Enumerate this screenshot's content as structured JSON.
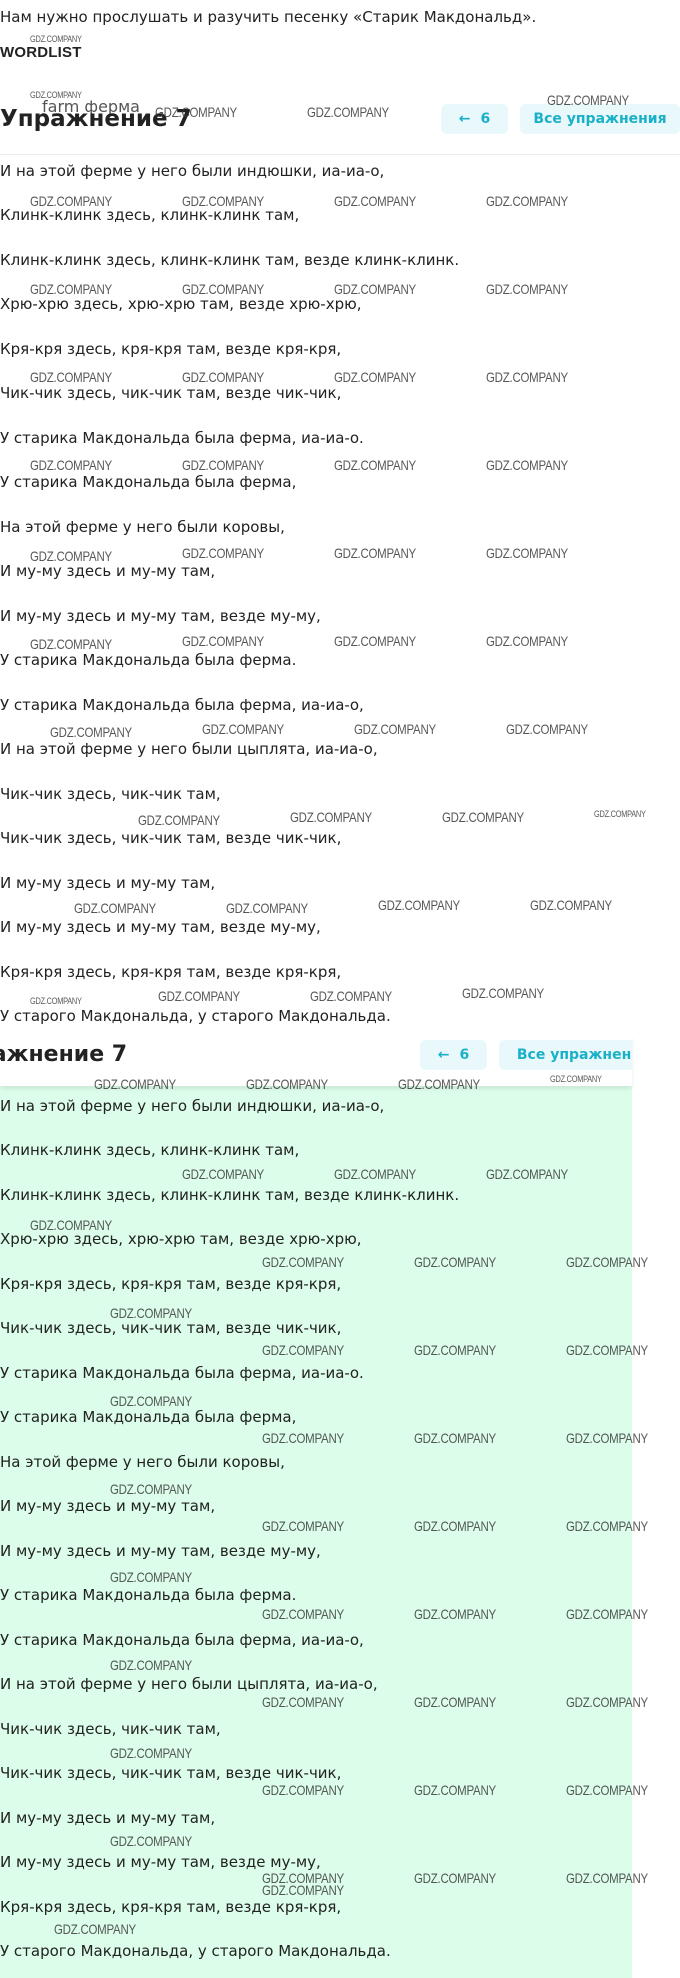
{
  "intro_text": "Нам нужно прослушать и разучить песенку «Старик Макдональд».",
  "wordlist_label": "WORDLIST",
  "farm_ghost": "farm  ферма",
  "watermark": "GDZ.COMPANY",
  "exercise": {
    "title": "Упражнение 7",
    "title_cut": "ражнение 7",
    "prev_number": "6",
    "all_exercises": "Все упражнения",
    "all_exercises_cut": "Все упражнени"
  },
  "colors": {
    "accent": "#1ab0c8",
    "button_bg": "#e8f8fb",
    "answer_bg": "#dcfdea"
  },
  "icons": {
    "prev": "arrow-left-icon"
  },
  "song_lines": [
    "И на этой ферме у него были индюшки, иа-иа-о,",
    "Клинк-клинк здесь, клинк-клинк там,",
    "Клинк-клинк здесь, клинк-клинк там, везде клинк-клинк.",
    "Хрю-хрю здесь, хрю-хрю там, везде хрю-хрю,",
    "Кря-кря здесь, кря-кря там, везде кря-кря,",
    "Чик-чик здесь, чик-чик там, везде чик-чик,",
    "У старика Макдональда была ферма, иа-иа-о.",
    "У старика Макдональда была ферма,",
    "На этой ферме у него были коровы,",
    "И му-му здесь и му-му там,",
    "И му-му здесь и му-му там, везде му-му,",
    "У старика Макдональда была ферма.",
    "У старика Макдональда была ферма, иа-иа-о,",
    "И на этой ферме у него были цыплята, иа-иа-о,",
    "Чик-чик здесь, чик-чик там,",
    "Чик-чик здесь, чик-чик там, везде чик-чик,",
    "И му-му здесь и му-му там,",
    "И му-му здесь и му-му там, везде му-му,",
    "Кря-кря здесь, кря-кря там, везде кря-кря,",
    "У старого Макдональда, у старого Макдональда."
  ]
}
